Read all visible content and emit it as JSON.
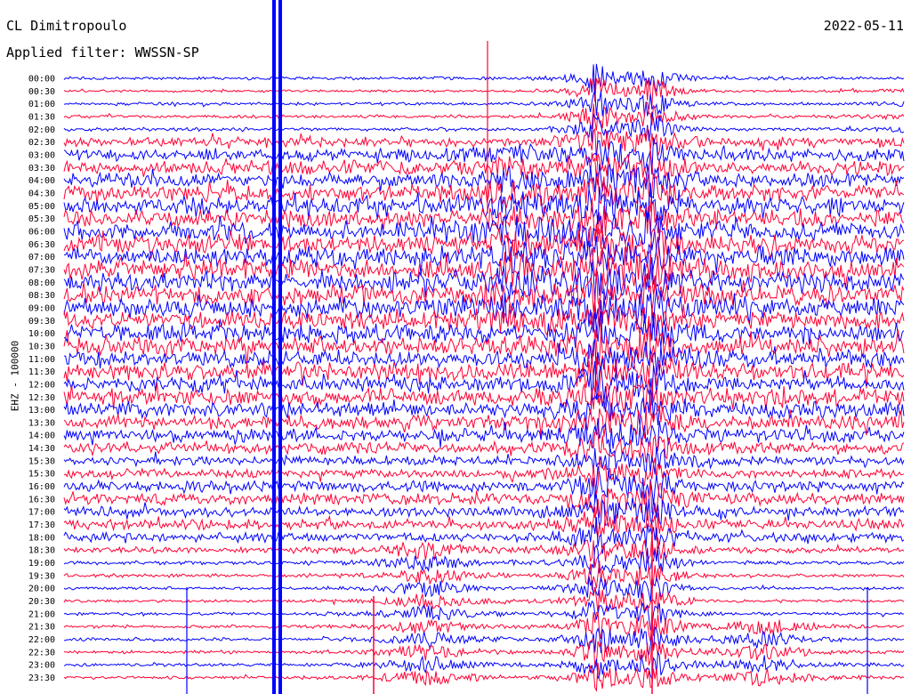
{
  "header": {
    "station": "CL Dimitropoulo",
    "filter": "Applied filter: WWSSN-SP",
    "date": "2022-05-11"
  },
  "chart_data": {
    "type": "line",
    "title": "CL Dimitropoulo",
    "subtitle": "Applied filter: WWSSN-SP",
    "date": "2022-05-11",
    "ylabel": "EHZ - 100000",
    "xlabel": "",
    "rows": [
      "00:00",
      "00:30",
      "01:00",
      "01:30",
      "02:00",
      "02:30",
      "03:00",
      "03:30",
      "04:00",
      "04:30",
      "05:00",
      "05:30",
      "06:00",
      "06:30",
      "07:00",
      "07:30",
      "08:00",
      "08:30",
      "09:00",
      "09:30",
      "10:00",
      "10:30",
      "11:00",
      "11:30",
      "12:00",
      "12:30",
      "13:00",
      "13:30",
      "14:00",
      "14:30",
      "15:00",
      "15:30",
      "16:00",
      "16:30",
      "17:00",
      "17:30",
      "18:00",
      "18:30",
      "19:00",
      "19:30",
      "20:00",
      "20:30",
      "21:00",
      "21:30",
      "22:00",
      "22:30",
      "23:00",
      "23:30"
    ],
    "tick_labels": [
      "00:00",
      "00:30",
      "01:00",
      "01:30",
      "02:00",
      "02:30",
      "03:00",
      "03:30",
      "04:00",
      "04:30",
      "05:00",
      "05:30",
      "06:00",
      "06:30",
      "07:00",
      "07:30",
      "08:00",
      "08:30",
      "09:00",
      "09:30",
      "10:00",
      "10:30",
      "11:00",
      "11:30",
      "12:00",
      "12:30",
      "13:00",
      "13:30",
      "14:00",
      "14:30",
      "15:30",
      "15:30",
      "16:00",
      "16:30",
      "17:00",
      "17:30",
      "18:00",
      "18:30",
      "19:00",
      "19:30",
      "20:00",
      "20:30",
      "21:00",
      "21:30",
      "22:00",
      "22:30",
      "23:00",
      "23:30"
    ],
    "trace_colors": [
      "#0000ff",
      "#ff0033"
    ],
    "relative_amplitude": [
      0.3,
      0.25,
      0.3,
      0.3,
      0.35,
      0.9,
      1.2,
      1.3,
      1.4,
      1.5,
      1.6,
      1.7,
      1.8,
      1.8,
      1.9,
      1.9,
      1.9,
      1.9,
      1.9,
      1.8,
      1.8,
      1.8,
      1.7,
      1.7,
      1.6,
      1.6,
      1.5,
      1.4,
      1.3,
      1.1,
      0.9,
      0.9,
      1.1,
      1.1,
      1.0,
      1.0,
      0.9,
      0.6,
      0.4,
      0.35,
      0.3,
      0.3,
      0.3,
      0.3,
      0.3,
      0.3,
      0.3,
      0.3
    ],
    "events": [
      {
        "time_min": 19,
        "start_row": "00:00",
        "end_row": "23:30",
        "type": "saturated trace"
      },
      {
        "time_min": 21,
        "start_row": "00:00",
        "end_row": "23:30",
        "type": "saturated trace"
      },
      {
        "time_min": 16,
        "start_row": "03:00",
        "end_row": "09:30",
        "type": "strong event"
      },
      {
        "time_min": 32,
        "start_row": "00:30",
        "end_row": "03:30",
        "type": "spike"
      },
      {
        "time_min": 25,
        "start_row": "21:30",
        "end_row": "23:30",
        "type": "event"
      },
      {
        "time_min": 45,
        "start_row": "20:30",
        "end_row": "23:00",
        "type": "event"
      },
      {
        "time_min": 13,
        "start_row": "18:30",
        "end_row": "23:30",
        "type": "event"
      },
      {
        "time_min": 58,
        "start_row": "21:30",
        "end_row": "22:30",
        "type": "event"
      }
    ]
  }
}
